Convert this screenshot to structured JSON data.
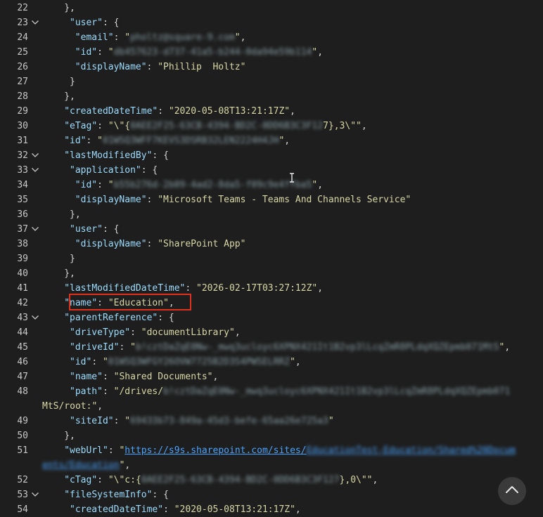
{
  "lines": [
    {
      "n": "22",
      "fold": false,
      "indent": 4,
      "parts": [
        {
          "t": "p",
          "v": "},"
        }
      ]
    },
    {
      "n": "23",
      "fold": true,
      "indent": 5,
      "parts": [
        {
          "t": "k",
          "v": "\"user\""
        },
        {
          "t": "p",
          "v": ": {"
        }
      ]
    },
    {
      "n": "24",
      "fold": false,
      "indent": 6,
      "parts": [
        {
          "t": "k",
          "v": "\"email\""
        },
        {
          "t": "p",
          "v": ": "
        },
        {
          "t": "s",
          "v": "\""
        },
        {
          "t": "b",
          "v": "pholtz@square-9.com"
        },
        {
          "t": "s",
          "v": "\""
        },
        {
          "t": "p",
          "v": ","
        }
      ]
    },
    {
      "n": "25",
      "fold": false,
      "indent": 6,
      "parts": [
        {
          "t": "k",
          "v": "\"id\""
        },
        {
          "t": "p",
          "v": ": "
        },
        {
          "t": "s",
          "v": "\""
        },
        {
          "t": "b",
          "v": "db457623-d737-41a5-b244-0da94e59b114"
        },
        {
          "t": "s",
          "v": "\""
        },
        {
          "t": "p",
          "v": ","
        }
      ]
    },
    {
      "n": "26",
      "fold": false,
      "indent": 6,
      "parts": [
        {
          "t": "k",
          "v": "\"displayName\""
        },
        {
          "t": "p",
          "v": ": "
        },
        {
          "t": "s",
          "v": "\"Phillip  Holtz\""
        }
      ]
    },
    {
      "n": "27",
      "fold": false,
      "indent": 5,
      "parts": [
        {
          "t": "p",
          "v": "}"
        }
      ]
    },
    {
      "n": "28",
      "fold": false,
      "indent": 4,
      "parts": [
        {
          "t": "p",
          "v": "},"
        }
      ]
    },
    {
      "n": "29",
      "fold": false,
      "indent": 4,
      "parts": [
        {
          "t": "k",
          "v": "\"createdDateTime\""
        },
        {
          "t": "p",
          "v": ": "
        },
        {
          "t": "s",
          "v": "\"2020-05-08T13:21:17Z\""
        },
        {
          "t": "p",
          "v": ","
        }
      ]
    },
    {
      "n": "30",
      "fold": false,
      "indent": 4,
      "parts": [
        {
          "t": "k",
          "v": "\"eTag\""
        },
        {
          "t": "p",
          "v": ": "
        },
        {
          "t": "s",
          "v": "\"\\\"{"
        },
        {
          "t": "b",
          "v": "0AEE2F25-63CB-4394-BD2C-0DD6B3C3F12"
        },
        {
          "t": "s",
          "v": "7},3\\\"\""
        },
        {
          "t": "p",
          "v": ","
        }
      ]
    },
    {
      "n": "31",
      "fold": false,
      "indent": 4,
      "parts": [
        {
          "t": "k",
          "v": "\"id\""
        },
        {
          "t": "p",
          "v": ": "
        },
        {
          "t": "s",
          "v": "\""
        },
        {
          "t": "b",
          "v": "01WSQ3WFF7KEVS3DSRB32LEN2224H4JH"
        },
        {
          "t": "s",
          "v": "\""
        },
        {
          "t": "p",
          "v": ","
        }
      ]
    },
    {
      "n": "32",
      "fold": true,
      "indent": 4,
      "parts": [
        {
          "t": "k",
          "v": "\"lastModifiedBy\""
        },
        {
          "t": "p",
          "v": ": {"
        }
      ]
    },
    {
      "n": "33",
      "fold": true,
      "indent": 5,
      "parts": [
        {
          "t": "k",
          "v": "\"application\""
        },
        {
          "t": "p",
          "v": ": {"
        }
      ]
    },
    {
      "n": "34",
      "fold": false,
      "indent": 6,
      "parts": [
        {
          "t": "k",
          "v": "\"id\""
        },
        {
          "t": "p",
          "v": ": "
        },
        {
          "t": "s",
          "v": "\""
        },
        {
          "t": "b",
          "v": "b55b276d-2b09-4ad2-8da5-f09c9e4ffba5"
        },
        {
          "t": "s",
          "v": "\""
        },
        {
          "t": "p",
          "v": ","
        }
      ]
    },
    {
      "n": "35",
      "fold": false,
      "indent": 6,
      "parts": [
        {
          "t": "k",
          "v": "\"displayName\""
        },
        {
          "t": "p",
          "v": ": "
        },
        {
          "t": "s",
          "v": "\"Microsoft Teams - Teams And Channels Service\""
        }
      ]
    },
    {
      "n": "36",
      "fold": false,
      "indent": 5,
      "parts": [
        {
          "t": "p",
          "v": "},"
        }
      ]
    },
    {
      "n": "37",
      "fold": true,
      "indent": 5,
      "parts": [
        {
          "t": "k",
          "v": "\"user\""
        },
        {
          "t": "p",
          "v": ": {"
        }
      ]
    },
    {
      "n": "38",
      "fold": false,
      "indent": 6,
      "parts": [
        {
          "t": "k",
          "v": "\"displayName\""
        },
        {
          "t": "p",
          "v": ": "
        },
        {
          "t": "s",
          "v": "\"SharePoint App\""
        }
      ]
    },
    {
      "n": "39",
      "fold": false,
      "indent": 5,
      "parts": [
        {
          "t": "p",
          "v": "}"
        }
      ]
    },
    {
      "n": "40",
      "fold": false,
      "indent": 4,
      "parts": [
        {
          "t": "p",
          "v": "},"
        }
      ]
    },
    {
      "n": "41",
      "fold": false,
      "indent": 4,
      "parts": [
        {
          "t": "k",
          "v": "\"lastModifiedDateTime\""
        },
        {
          "t": "p",
          "v": ": "
        },
        {
          "t": "s",
          "v": "\"2026-02-17T03:27:12Z\""
        },
        {
          "t": "p",
          "v": ","
        }
      ]
    },
    {
      "n": "42",
      "fold": false,
      "indent": 4,
      "parts": [
        {
          "t": "k",
          "v": "\"name\""
        },
        {
          "t": "p",
          "v": ": "
        },
        {
          "t": "s",
          "v": "\"Education\""
        },
        {
          "t": "p",
          "v": ","
        }
      ]
    },
    {
      "n": "43",
      "fold": true,
      "indent": 4,
      "parts": [
        {
          "t": "k",
          "v": "\"parentReference\""
        },
        {
          "t": "p",
          "v": ": {"
        }
      ]
    },
    {
      "n": "44",
      "fold": false,
      "indent": 5,
      "parts": [
        {
          "t": "k",
          "v": "\"driveType\""
        },
        {
          "t": "p",
          "v": ": "
        },
        {
          "t": "s",
          "v": "\"documentLibrary\""
        },
        {
          "t": "p",
          "v": ","
        }
      ]
    },
    {
      "n": "45",
      "fold": false,
      "indent": 5,
      "parts": [
        {
          "t": "k",
          "v": "\"driveId\""
        },
        {
          "t": "p",
          "v": ": "
        },
        {
          "t": "s",
          "v": "\""
        },
        {
          "t": "b",
          "v": "b!cztDaZqE0Nw-_mwq3ucloyc6XPNX421It1B2vp3lLcqZmR8PLdqXQZEpmb071MtS"
        },
        {
          "t": "s",
          "v": "\""
        },
        {
          "t": "p",
          "v": ","
        }
      ]
    },
    {
      "n": "46",
      "fold": false,
      "indent": 5,
      "parts": [
        {
          "t": "k",
          "v": "\"id\""
        },
        {
          "t": "p",
          "v": ": "
        },
        {
          "t": "s",
          "v": "\""
        },
        {
          "t": "b",
          "v": "01WSQ3WFGY26OVW7725B2D3S4PWSELRRZ"
        },
        {
          "t": "s",
          "v": "\""
        },
        {
          "t": "p",
          "v": ","
        }
      ]
    },
    {
      "n": "47",
      "fold": false,
      "indent": 5,
      "parts": [
        {
          "t": "k",
          "v": "\"name\""
        },
        {
          "t": "p",
          "v": ": "
        },
        {
          "t": "s",
          "v": "\"Shared Documents\""
        },
        {
          "t": "p",
          "v": ","
        }
      ]
    },
    {
      "n": "48",
      "fold": false,
      "indent": 5,
      "parts": [
        {
          "t": "k",
          "v": "\"path\""
        },
        {
          "t": "p",
          "v": ": "
        },
        {
          "t": "s",
          "v": "\"/drives/"
        },
        {
          "t": "b",
          "v": "b!cztDaZqE0Nw-_mwq3ucloyc6XPNX421It1B2vp3lLcqZmR8PLdqXQZEpmb071"
        }
      ]
    },
    {
      "n": "",
      "fold": false,
      "indent": 0,
      "parts": [
        {
          "t": "s",
          "v": "MtS/root:\""
        },
        {
          "t": "p",
          "v": ","
        }
      ]
    },
    {
      "n": "49",
      "fold": false,
      "indent": 5,
      "parts": [
        {
          "t": "k",
          "v": "\"siteId\""
        },
        {
          "t": "p",
          "v": ": "
        },
        {
          "t": "s",
          "v": "\""
        },
        {
          "t": "b",
          "v": "69433b73-849a-45d3-befe-65aa26e725a3"
        },
        {
          "t": "s",
          "v": "\""
        }
      ]
    },
    {
      "n": "50",
      "fold": false,
      "indent": 4,
      "parts": [
        {
          "t": "p",
          "v": "},"
        }
      ]
    },
    {
      "n": "51",
      "fold": false,
      "indent": 4,
      "parts": [
        {
          "t": "k",
          "v": "\"webUrl\""
        },
        {
          "t": "p",
          "v": ": "
        },
        {
          "t": "s",
          "v": "\""
        },
        {
          "t": "a",
          "v": "https://s9s.sharepoint.com/sites/"
        },
        {
          "t": "ba",
          "v": "EducationTest-Education/Shared%20Docum"
        }
      ]
    },
    {
      "n": "",
      "fold": false,
      "indent": 0,
      "parts": [
        {
          "t": "ba",
          "v": "ents/Education"
        },
        {
          "t": "s",
          "v": "\""
        },
        {
          "t": "p",
          "v": ","
        }
      ]
    },
    {
      "n": "52",
      "fold": false,
      "indent": 4,
      "parts": [
        {
          "t": "k",
          "v": "\"cTag\""
        },
        {
          "t": "p",
          "v": ": "
        },
        {
          "t": "s",
          "v": "\"\\\"c:{"
        },
        {
          "t": "b",
          "v": "0AEE2F25-63CB-4394-BD2C-0DD6B3C3F127"
        },
        {
          "t": "s",
          "v": "},0\\\"\""
        },
        {
          "t": "p",
          "v": ","
        }
      ]
    },
    {
      "n": "53",
      "fold": true,
      "indent": 4,
      "parts": [
        {
          "t": "k",
          "v": "\"fileSystemInfo\""
        },
        {
          "t": "p",
          "v": ": {"
        }
      ]
    },
    {
      "n": "54",
      "fold": false,
      "indent": 5,
      "parts": [
        {
          "t": "k",
          "v": "\"createdDateTime\""
        },
        {
          "t": "p",
          "v": ": "
        },
        {
          "t": "s",
          "v": "\"2020-05-08T13:21:17Z\""
        },
        {
          "t": "p",
          "v": ","
        }
      ]
    }
  ],
  "colors": {
    "background": "#1e1e1e",
    "key": "#9cdcfe",
    "string": "#d7d7a6",
    "link": "#4aa3ff",
    "highlight_border": "#e0301e"
  },
  "icons": {
    "fold": "chevron-down-icon",
    "scroll_top": "chevron-up-icon",
    "cursor": "text-cursor-icon"
  }
}
